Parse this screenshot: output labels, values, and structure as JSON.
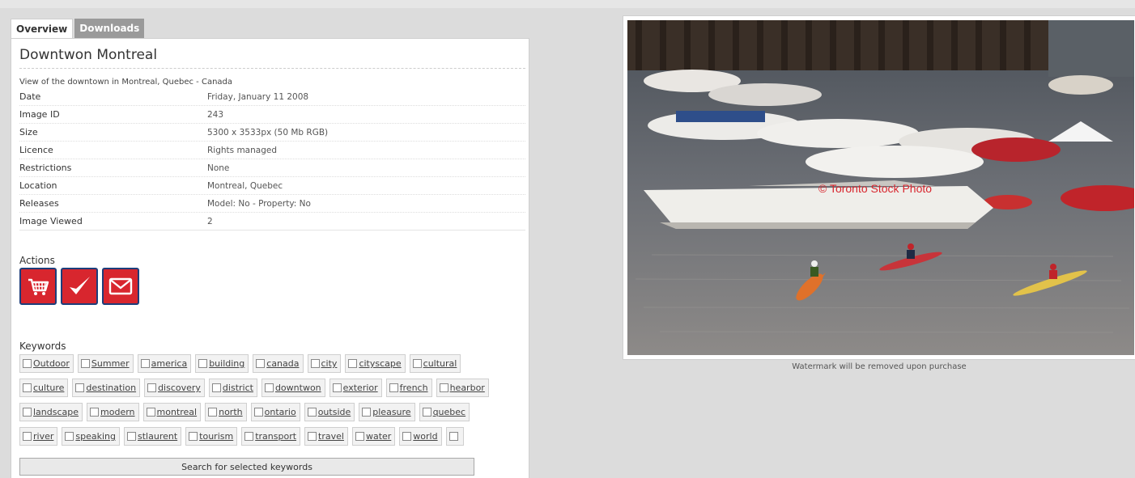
{
  "tabs": [
    {
      "label": "Overview",
      "active": true
    },
    {
      "label": "Downloads",
      "active": false
    }
  ],
  "image": {
    "title": "Downtwon Montreal",
    "description": "View of the downtown in Montreal, Quebec - Canada",
    "watermark": "© Toronto Stock Photo",
    "note": "Watermark will be removed upon purchase"
  },
  "properties": [
    {
      "label": "Date",
      "value": "Friday, January 11 2008"
    },
    {
      "label": "Image ID",
      "value": "243"
    },
    {
      "label": "Size",
      "value": "5300 x 3533px (50 Mb RGB)"
    },
    {
      "label": "Licence",
      "value": "Rights managed"
    },
    {
      "label": "Restrictions",
      "value": "None"
    },
    {
      "label": "Location",
      "value": "Montreal, Quebec"
    },
    {
      "label": "Releases",
      "value": "Model: No - Property: No"
    },
    {
      "label": "Image Viewed",
      "value": "2"
    }
  ],
  "actions": {
    "label": "Actions",
    "items": [
      {
        "icon": "cart-icon"
      },
      {
        "icon": "checkmark-icon"
      },
      {
        "icon": "envelope-icon"
      }
    ]
  },
  "keywords": {
    "label": "Keywords",
    "items": [
      "Outdoor",
      "Summer",
      "america",
      "building",
      "canada",
      "city",
      "cityscape",
      "cultural",
      "culture",
      "destination",
      "discovery",
      "district",
      "downtwon",
      "exterior",
      "french",
      "hearbor",
      "landscape",
      "modern",
      "montreal",
      "north",
      "ontario",
      "outside",
      "pleasure",
      "quebec",
      "river",
      "speaking",
      "stlaurent",
      "tourism",
      "transport",
      "travel",
      "water",
      "world",
      ""
    ],
    "search_label": "Search for selected keywords"
  },
  "colors": {
    "accent_red": "#d8262e",
    "accent_border": "#1d3d7a",
    "tab_inactive": "#9a9a9a"
  }
}
